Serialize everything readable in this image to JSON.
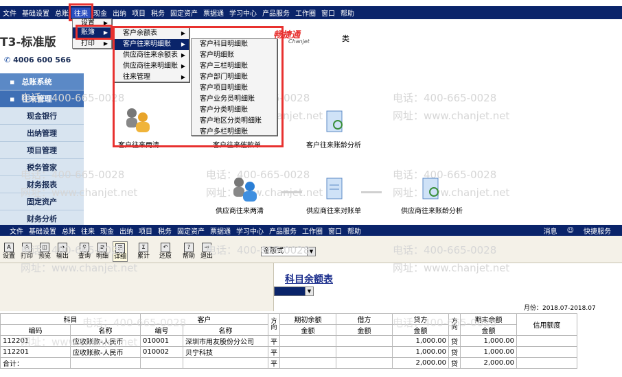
{
  "top_menu": [
    "文件",
    "基础设置",
    "总账",
    "往来",
    "现金",
    "出纳",
    "项目",
    "税务",
    "固定资产",
    "票据通",
    "学习中心",
    "产品服务",
    "工作圈",
    "窗口",
    "帮助"
  ],
  "bottom_menu": [
    "文件",
    "基础设置",
    "总账",
    "往来",
    "现金",
    "出纳",
    "项目",
    "税务",
    "固定资产",
    "票据通",
    "学习中心",
    "产品服务",
    "工作圈",
    "窗口",
    "帮助"
  ],
  "bottom_right": {
    "msg": "消息",
    "fav": "快捷服务"
  },
  "brand": {
    "title": "T3-标准版",
    "phone": "4006 600 566",
    "partner": "畅捷通",
    "partner_en": "Chanjet",
    "tail": "类"
  },
  "sidebar": [
    "总账系统",
    "往来管理",
    "现金银行",
    "出纳管理",
    "项目管理",
    "税务管家",
    "财务报表",
    "固定资产",
    "财务分析"
  ],
  "menu_level1": [
    {
      "label": "设置"
    },
    {
      "label": "账簿"
    },
    {
      "label": "打印"
    }
  ],
  "menu_level2": [
    "客户余额表",
    "客户往来明细账",
    "供应商往来余额表",
    "供应商往来明细账",
    "往来管理"
  ],
  "menu_level3": [
    "客户科目明细账",
    "客户明细账",
    "客户三栏明细账",
    "客户部门明细账",
    "客户项目明细账",
    "客户业务员明细账",
    "客户分类明细账",
    "客户地区分类明细账",
    "客户多栏明细账"
  ],
  "flow": {
    "c1": "客户往来两清",
    "c2": "客户往来催款单",
    "c3": "客户往来账龄分析",
    "s1": "供应商往来两清",
    "s2": "供应商往来对账单",
    "s3": "供应商往来账龄分析"
  },
  "toolbar": [
    "设置",
    "打印",
    "预览",
    "输出",
    "查询",
    "明细",
    "详细",
    "累计",
    "还原",
    "帮助",
    "退出"
  ],
  "format_select": "金额式",
  "report": {
    "title": "科目余额表",
    "period": "月份：2018.07-2018.07"
  },
  "watermark": {
    "phone": "电话：400-665-0028",
    "site": "网址：www.chanjet.net"
  },
  "table": {
    "group_headers": {
      "subject": "科目",
      "customer": "客户",
      "direction": "方向",
      "opening": "期初余额",
      "debit": "借方",
      "credit": "贷方",
      "direction2": "方向",
      "closing": "期末余额",
      "credit_limit": "信用额度"
    },
    "sub_headers": {
      "code": "编码",
      "name": "名称",
      "cust_code": "编号",
      "cust_name": "名称",
      "amount": "金额"
    },
    "rows": [
      {
        "code": "112201",
        "name": "应收账款-人民币",
        "cust_code": "010001",
        "cust_name": "深圳市用友股份分公司",
        "dir": "平",
        "opening": "",
        "debit": "",
        "credit": "1,000.00",
        "dir2": "贷",
        "closing": "1,000.00",
        "limit": ""
      },
      {
        "code": "112201",
        "name": "应收账款-人民币",
        "cust_code": "010002",
        "cust_name": "贝宁科技",
        "dir": "平",
        "opening": "",
        "debit": "",
        "credit": "1,000.00",
        "dir2": "贷",
        "closing": "1,000.00",
        "limit": ""
      },
      {
        "code": "合计：",
        "name": "",
        "cust_code": "",
        "cust_name": "",
        "dir": "平",
        "opening": "",
        "debit": "",
        "credit": "2,000.00",
        "dir2": "贷",
        "closing": "2,000.00",
        "limit": ""
      }
    ]
  }
}
